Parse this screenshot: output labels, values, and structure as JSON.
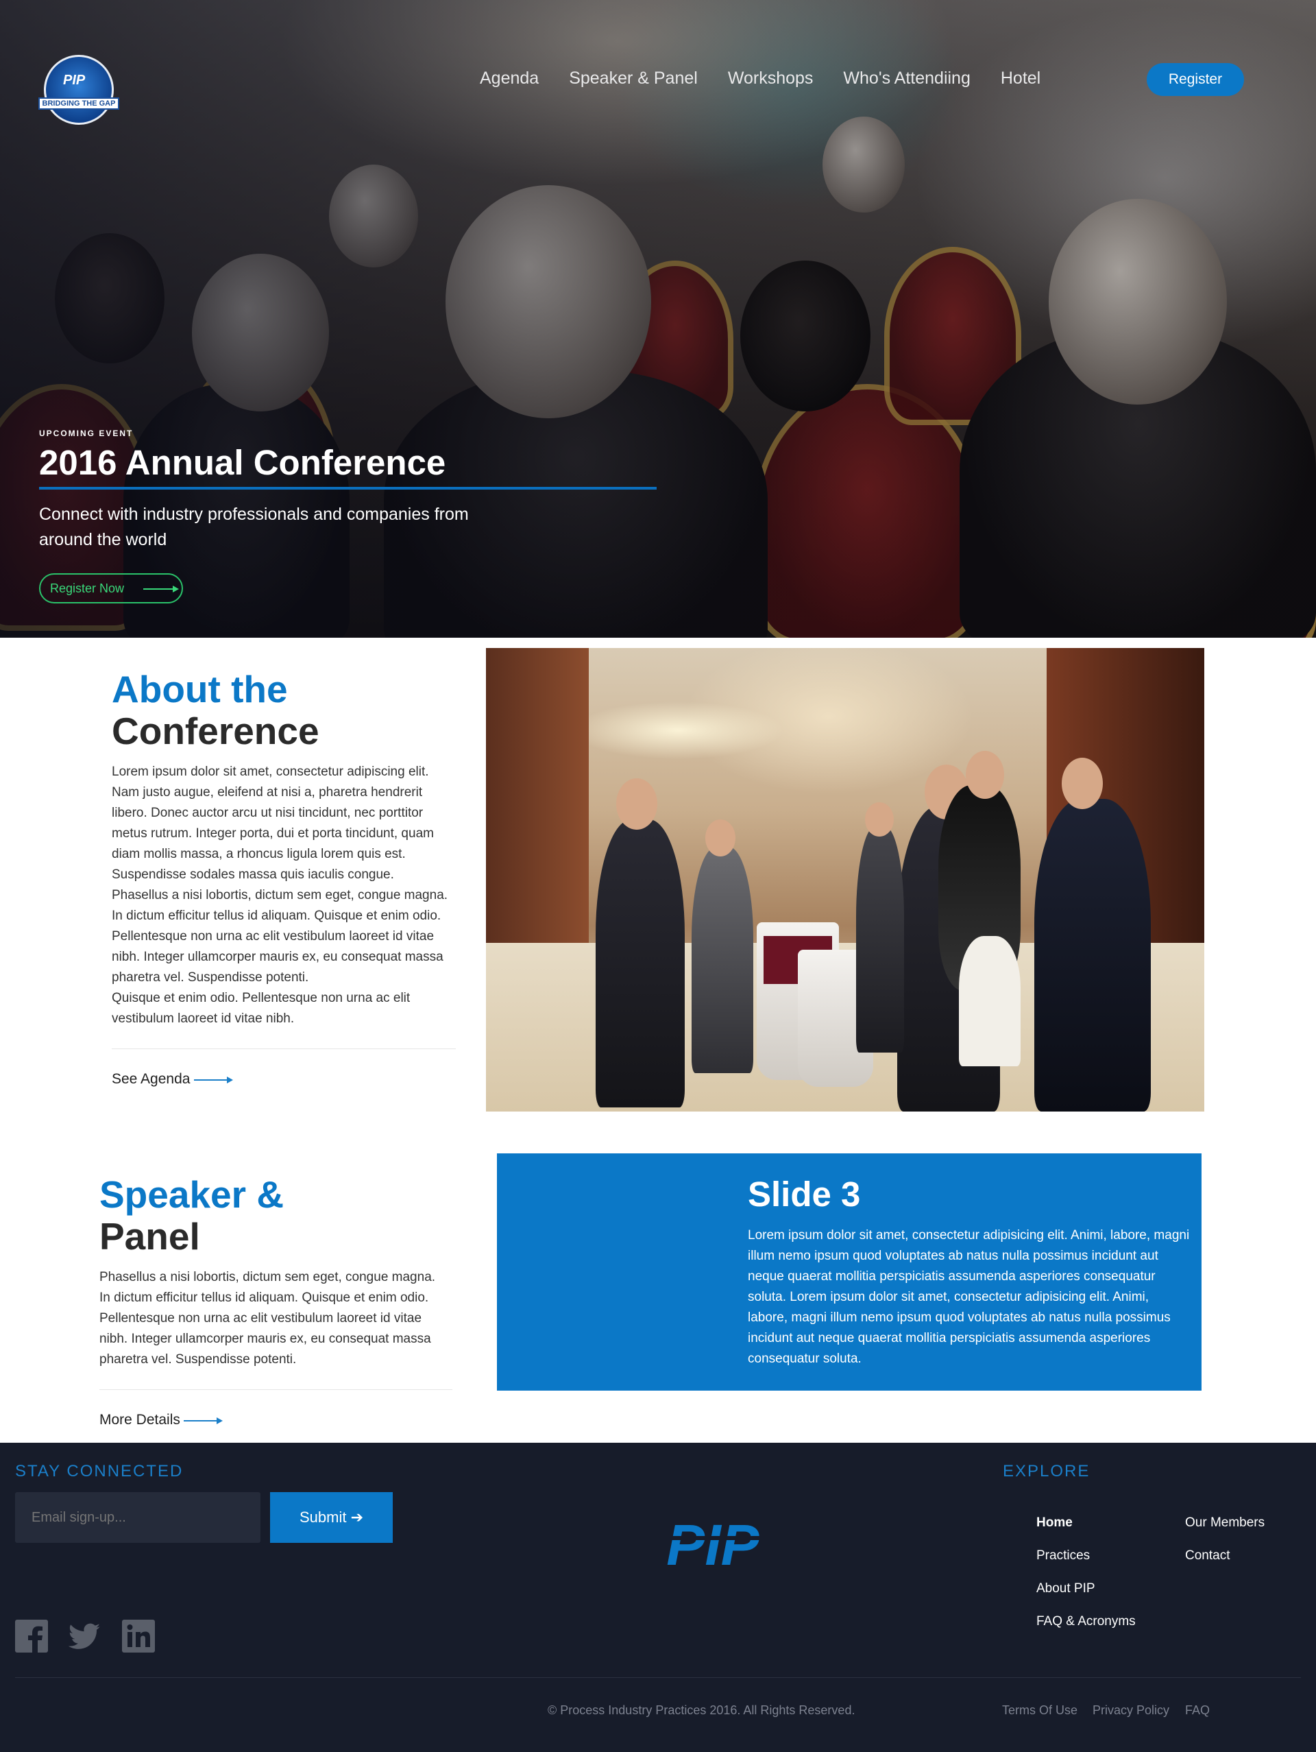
{
  "brand": {
    "logo_text": "PIP",
    "logo_tagline": "BRIDGING THE GAP"
  },
  "nav": {
    "items": [
      "Agenda",
      "Speaker & Panel",
      "Workshops",
      "Who's Attendiing",
      "Hotel"
    ],
    "register_label": "Register"
  },
  "hero": {
    "eyebrow": "UPCOMING EVENT",
    "title": "2016 Annual Conference",
    "subtitle": "Connect with industry professionals and companies from around the world",
    "cta_label": "Register Now"
  },
  "about": {
    "title_line1": "About the",
    "title_line2": "Conference",
    "body": "Lorem ipsum dolor sit amet, consectetur adipiscing elit. Nam justo augue, eleifend at nisi a, pharetra hendrerit libero. Donec auctor arcu ut nisi tincidunt, nec porttitor metus rutrum. Integer porta, dui et porta tincidunt, quam diam mollis massa, a rhoncus ligula lorem quis est. Suspendisse sodales massa quis iaculis congue.\nPhasellus a nisi lobortis, dictum sem eget, congue magna. In dictum efficitur tellus id aliquam. Quisque et enim odio. Pellentesque non urna ac elit vestibulum laoreet id vitae nibh. Integer ullamcorper mauris ex, eu consequat massa pharetra vel. Suspendisse potenti.\nQuisque et enim odio. Pellentesque non urna ac elit vestibulum laoreet id vitae nibh.",
    "link_label": "See Agenda"
  },
  "speaker": {
    "title_line1": "Speaker &",
    "title_line2": "Panel",
    "body": "Phasellus a nisi lobortis, dictum sem eget, congue magna. In dictum efficitur tellus id aliquam. Quisque et enim odio. Pellentesque non urna ac elit vestibulum laoreet id vitae nibh. Integer ullamcorper mauris ex, eu consequat massa pharetra vel. Suspendisse potenti.",
    "link_label": "More Details"
  },
  "slide": {
    "title": "Slide 3",
    "body": "Lorem ipsum dolor sit amet, consectetur adipisicing elit. Animi, labore, magni illum nemo ipsum quod voluptates ab natus nulla possimus incidunt aut neque quaerat mollitia perspiciatis assumenda asperiores consequatur soluta. Lorem ipsum dolor sit amet, consectetur adipisicing elit. Animi, labore, magni illum nemo ipsum quod voluptates ab natus nulla possimus incidunt aut neque quaerat mollitia perspiciatis assumenda asperiores consequatur soluta."
  },
  "footer": {
    "stay_connected": "STAY CONNECTED",
    "email_placeholder": "Email sign-up...",
    "submit_label": "Submit",
    "explore_heading": "EXPLORE",
    "explore_col1": [
      "Home",
      "Practices",
      "About PIP",
      "FAQ & Acronyms"
    ],
    "explore_col2": [
      "Our Members",
      "Contact"
    ],
    "copyright": "© Process Industry Practices 2016. All Rights Reserved.",
    "legal": [
      "Terms Of Use",
      "Privacy Policy",
      "FAQ"
    ],
    "social_icons": [
      "facebook-icon",
      "twitter-icon",
      "linkedin-icon"
    ]
  },
  "colors": {
    "brand_blue": "#0b78c7",
    "footer_bg": "#171c2a",
    "cta_green": "#39d97a"
  }
}
